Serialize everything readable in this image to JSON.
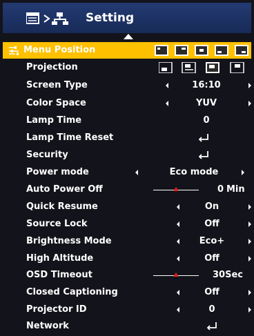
{
  "header": {
    "title": "Setting"
  },
  "menu": {
    "menu_position": {
      "label": "Menu Position"
    },
    "projection": {
      "label": "Projection"
    },
    "screen_type": {
      "label": "Screen Type",
      "value": "16:10"
    },
    "color_space": {
      "label": "Color Space",
      "value": "YUV"
    },
    "lamp_time": {
      "label": "Lamp Time",
      "value": "0"
    },
    "lamp_time_reset": {
      "label": "Lamp Time Reset"
    },
    "security": {
      "label": "Security"
    },
    "power_mode": {
      "label": "Power mode",
      "value": "Eco mode"
    },
    "auto_power_off": {
      "label": "Auto Power Off",
      "value": "0",
      "unit": "Min",
      "level": 0.5
    },
    "quick_resume": {
      "label": "Quick Resume",
      "value": "On"
    },
    "source_lock": {
      "label": "Source Lock",
      "value": "Off"
    },
    "brightness_mode": {
      "label": "Brightness Mode",
      "value": "Eco+"
    },
    "high_altitude": {
      "label": "High Altitude",
      "value": "Off"
    },
    "osd_timeout": {
      "label": "OSD Timeout",
      "value": "30Sec",
      "level": 0.5
    },
    "closed_captioning": {
      "label": "Closed Captioning",
      "value": "Off"
    },
    "projector_id": {
      "label": "Projector ID",
      "value": "0"
    },
    "network": {
      "label": "Network"
    }
  },
  "colors": {
    "background": "#13131b",
    "header": "#1f3466",
    "highlight": "#ffc000",
    "text": "#ffffff",
    "slider_knob": "#e02020"
  },
  "icons": {
    "header": [
      "list-icon",
      "chevron-right-icon",
      "network-icon"
    ],
    "selected": "sliders-icon",
    "enter": "enter-icon"
  }
}
